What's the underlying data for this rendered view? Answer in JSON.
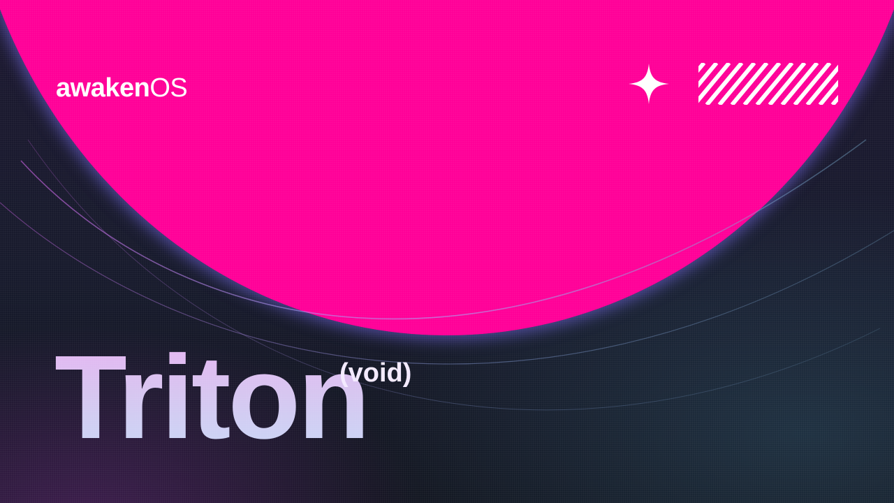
{
  "brand": {
    "name_bold": "awaken",
    "name_light": "OS"
  },
  "hero": {
    "title": "Triton",
    "subtitle": "(void)"
  },
  "decorations": {
    "sparkle": "four-point-star-icon",
    "stripes": "diagonal-stripes-icon"
  },
  "colors": {
    "sphere": "#ff0098",
    "sphere_rim": "#6f66e6",
    "background": "#171a2c",
    "title_text": "#d8c2ec",
    "text": "#ffffff"
  }
}
